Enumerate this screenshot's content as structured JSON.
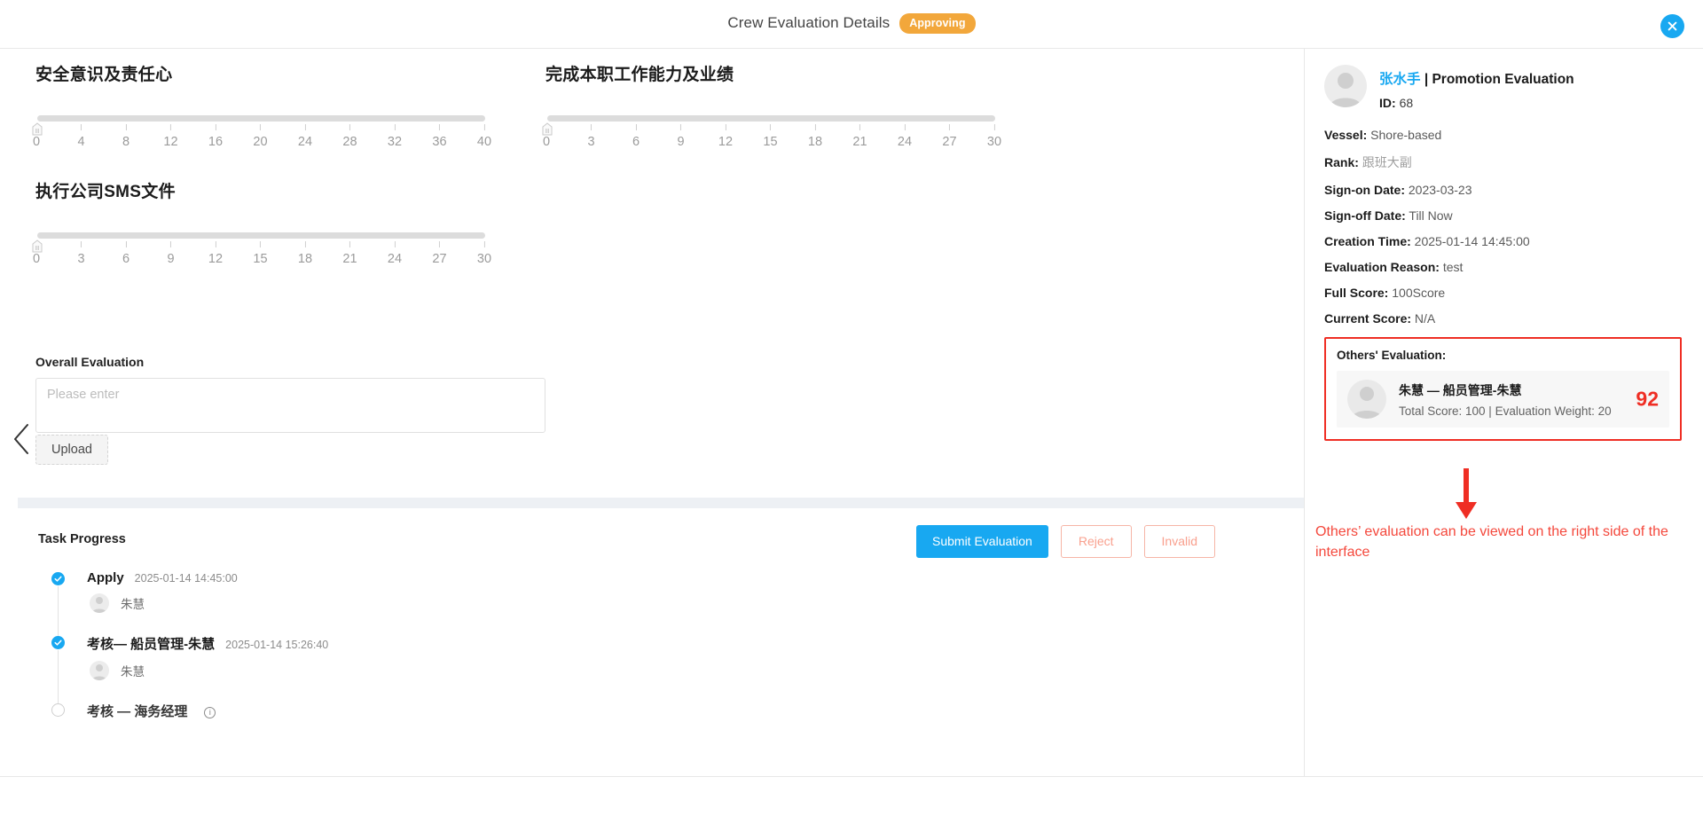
{
  "header": {
    "title": "Crew Evaluation Details",
    "status_badge": "Approving",
    "close_icon": "close-icon"
  },
  "sliders": [
    {
      "title": "安全意识及责任心",
      "min": 0,
      "max": 40,
      "step": 4,
      "value": 0,
      "ticks": [
        "0",
        "4",
        "8",
        "12",
        "16",
        "20",
        "24",
        "28",
        "32",
        "36",
        "40"
      ]
    },
    {
      "title": "完成本职工作能力及业绩",
      "min": 0,
      "max": 30,
      "step": 3,
      "value": 0,
      "ticks": [
        "0",
        "3",
        "6",
        "9",
        "12",
        "15",
        "18",
        "21",
        "24",
        "27",
        "30"
      ]
    },
    {
      "title": "执行公司SMS文件",
      "min": 0,
      "max": 30,
      "step": 3,
      "value": 0,
      "ticks": [
        "0",
        "3",
        "6",
        "9",
        "12",
        "15",
        "18",
        "21",
        "24",
        "27",
        "30"
      ]
    }
  ],
  "overall": {
    "label": "Overall Evaluation",
    "placeholder": "Please enter",
    "value": ""
  },
  "upload": {
    "label": "Upload"
  },
  "carousel": {
    "prev_icon": "chevron-left-icon",
    "next_icon": "chevron-right-icon"
  },
  "task": {
    "title": "Task Progress",
    "buttons": {
      "submit": "Submit Evaluation",
      "reject": "Reject",
      "invalid": "Invalid"
    },
    "steps": [
      {
        "name": "Apply",
        "time": "2025-01-14 14:45:00",
        "person": "朱慧",
        "state": "done"
      },
      {
        "name": "考核— 船员管理-朱慧",
        "time": "2025-01-14 15:26:40",
        "person": "朱慧",
        "state": "done"
      },
      {
        "name": "考核 — 海务经理",
        "time": "",
        "person": "",
        "state": "pending",
        "info_icon": "info-circle-icon"
      }
    ]
  },
  "detail_panel": {
    "crew_name": "张水手",
    "separator": " | ",
    "evaluation_type": "Promotion Evaluation",
    "id_label": "ID:",
    "id_value": "68",
    "fields": [
      {
        "label": "Vessel:",
        "value": "Shore-based",
        "muted": false
      },
      {
        "label": "Rank:",
        "value": "跟班大副",
        "muted": true
      },
      {
        "label": "Sign-on Date:",
        "value": "2023-03-23",
        "muted": false
      },
      {
        "label": "Sign-off Date:",
        "value": "Till Now",
        "muted": false
      },
      {
        "label": "Creation Time:",
        "value": "2025-01-14 14:45:00",
        "muted": false
      },
      {
        "label": "Evaluation Reason:",
        "value": "  test",
        "muted": false
      },
      {
        "label": "Full Score:",
        "value": "100Score",
        "muted": false
      },
      {
        "label": "Current Score:",
        "value": "N/A",
        "muted": false
      }
    ],
    "others": {
      "label": "Others' Evaluation:",
      "entries": [
        {
          "title": "朱慧 — 船员管理-朱慧",
          "subtitle": "Total Score: 100 | Evaluation Weight: 20",
          "score": "92"
        }
      ]
    }
  },
  "annotation": {
    "text": "Others’  evaluation can be viewed on the right side of the interface",
    "arrow_icon": "down-arrow-icon",
    "color": "#f4483c"
  },
  "colors": {
    "accent_blue": "#18a8f1",
    "badge_orange": "#f2a73b",
    "annotation_red": "#ef2e24",
    "danger_ghost": "#f9a08e"
  }
}
